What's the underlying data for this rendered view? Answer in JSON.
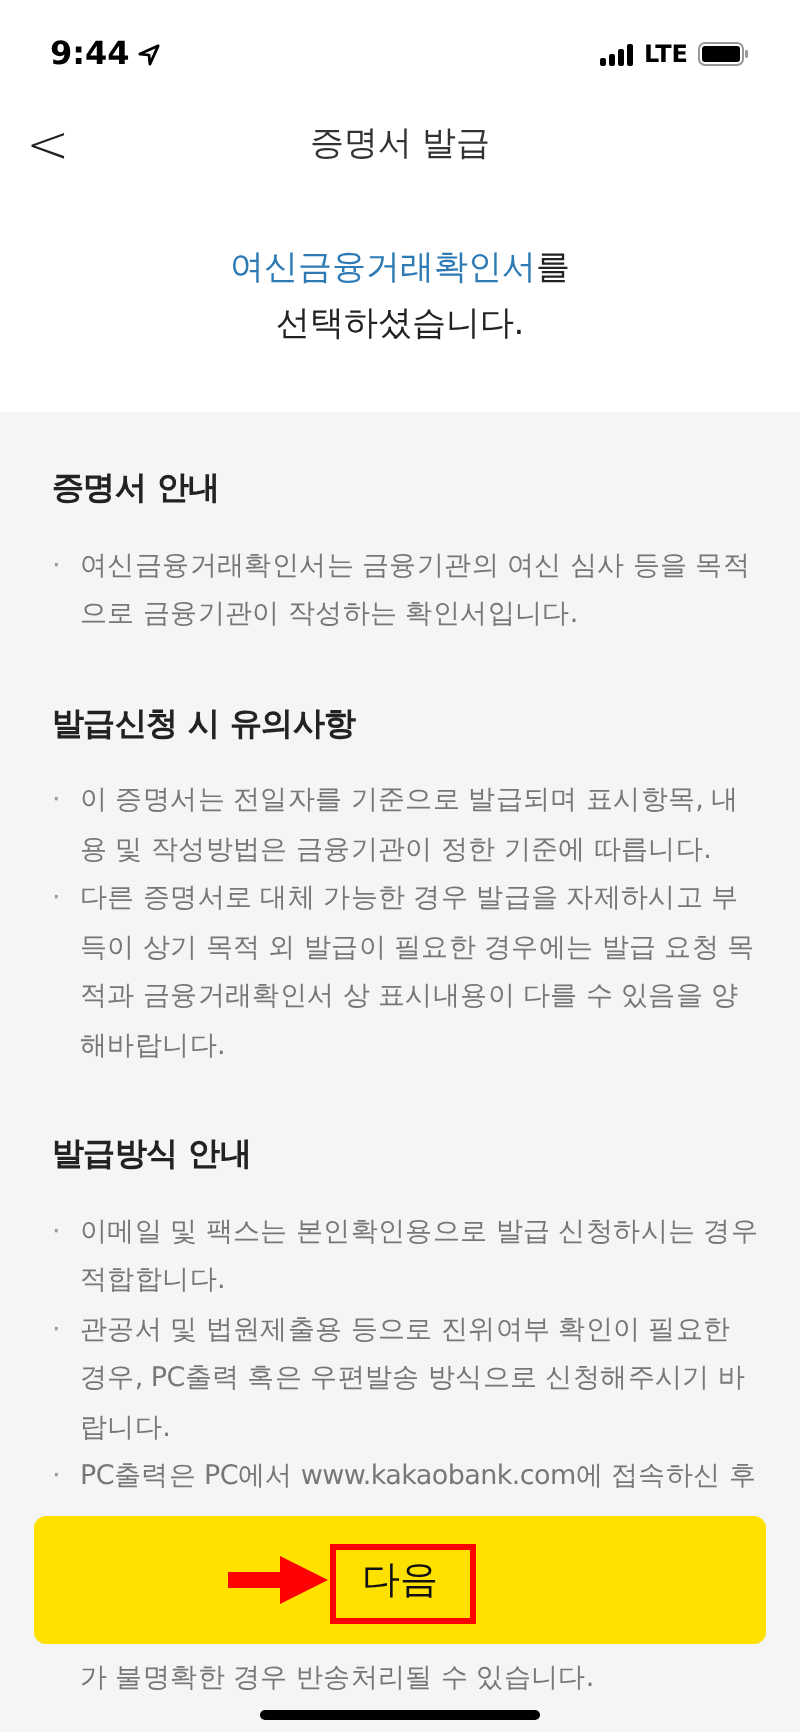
{
  "status_bar": {
    "time": "9:44",
    "network": "LTE"
  },
  "header": {
    "back": "<",
    "title": "증명서 발급"
  },
  "selection": {
    "document": "여신금융거래확인서",
    "suffix": "를",
    "line2": "선택하셨습니다."
  },
  "sections": [
    {
      "title": "증명서 안내",
      "bullets": [
        "여신금융거래확인서는 금융기관의 여신 심사 등을 목적으로 금융기관이 작성하는 확인서입니다."
      ]
    },
    {
      "title": "발급신청 시 유의사항",
      "bullets": [
        "이 증명서는 전일자를 기준으로 발급되며 표시항목, 내용 및 작성방법은 금융기관이 정한 기준에 따릅니다.",
        "다른 증명서로 대체 가능한 경우 발급을 자제하시고 부득이 상기 목적 외 발급이 필요한 경우에는 발급 요청 목적과 금융거래확인서 상 표시내용이 다를 수 있음을 양해바랍니다."
      ]
    },
    {
      "title": "발급방식 안내",
      "bullets": [
        "이메일 및 팩스는 본인확인용으로 발급 신청하시는 경우 적합합니다.",
        "관공서 및 법원제출용 등으로 진위여부 확인이 필요한 경우, PC출력 혹은 우편발송 방식으로 신청해주시기 바랍니다.",
        "PC출력은 PC에서 www.kakaobank.com에 접속하신 후"
      ],
      "continuation": "가 불명확한 경우 반송처리될 수 있습니다."
    }
  ],
  "bullet_mark": "·",
  "next_button": {
    "label": "다음"
  }
}
